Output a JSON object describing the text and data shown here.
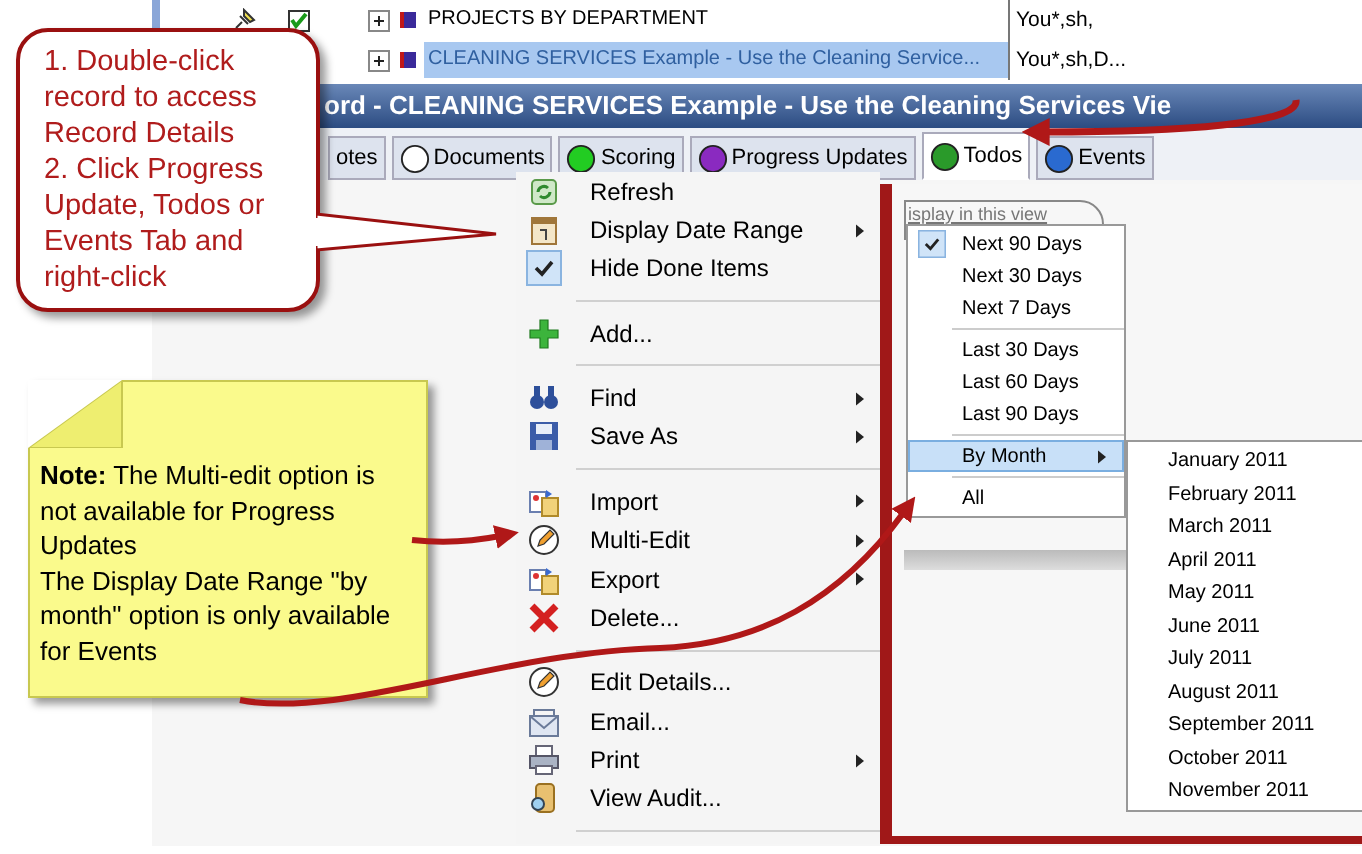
{
  "tree_rows": [
    {
      "label": "PROJECTS BY DEPARTMENT",
      "column_2": "You*,sh,",
      "selected": false
    },
    {
      "label": "CLEANING SERVICES Example - Use the Cleaning Service...",
      "column_2": "You*,sh,D...",
      "selected": true
    }
  ],
  "window": {
    "title": "ord - CLEANING SERVICES Example - Use the Cleaning Services Vie"
  },
  "tabs": [
    {
      "label": "otes",
      "selected": false
    },
    {
      "label": "Documents",
      "selected": false
    },
    {
      "label": "Scoring",
      "selected": false
    },
    {
      "label": "Progress Updates",
      "selected": false
    },
    {
      "label": "Todos",
      "selected": true
    },
    {
      "label": "Events",
      "selected": false
    }
  ],
  "context_menu": [
    {
      "kind": "item",
      "label": "Refresh",
      "submenu": false,
      "checked": false
    },
    {
      "kind": "item",
      "label": "Display Date Range",
      "submenu": true,
      "checked": false
    },
    {
      "kind": "item",
      "label": "Hide Done Items",
      "submenu": false,
      "checked": true
    },
    {
      "kind": "separator"
    },
    {
      "kind": "item",
      "label": "Add...",
      "submenu": false,
      "checked": false
    },
    {
      "kind": "separator"
    },
    {
      "kind": "item",
      "label": "Find",
      "submenu": true,
      "checked": false
    },
    {
      "kind": "item",
      "label": "Save As",
      "submenu": true,
      "checked": false
    },
    {
      "kind": "separator"
    },
    {
      "kind": "item",
      "label": "Import",
      "submenu": true,
      "checked": false
    },
    {
      "kind": "item",
      "label": "Multi-Edit",
      "submenu": true,
      "checked": false
    },
    {
      "kind": "item",
      "label": "Export",
      "submenu": true,
      "checked": false
    },
    {
      "kind": "item",
      "label": "Delete...",
      "submenu": false,
      "checked": false
    },
    {
      "kind": "separator"
    },
    {
      "kind": "item",
      "label": "Edit Details...",
      "submenu": false,
      "checked": false
    },
    {
      "kind": "item",
      "label": "Email...",
      "submenu": false,
      "checked": false
    },
    {
      "kind": "item",
      "label": "Print",
      "submenu": true,
      "checked": false
    },
    {
      "kind": "item",
      "label": "View Audit...",
      "submenu": false,
      "checked": false
    },
    {
      "kind": "separator"
    }
  ],
  "date_range_menu": {
    "caption": "isplay in this view",
    "items": [
      {
        "kind": "item",
        "label": "Next 90 Days",
        "checked": true,
        "selected": false,
        "submenu": false
      },
      {
        "kind": "item",
        "label": "Next 30 Days",
        "checked": false,
        "selected": false,
        "submenu": false
      },
      {
        "kind": "item",
        "label": "Next 7 Days",
        "checked": false,
        "selected": false,
        "submenu": false
      },
      {
        "kind": "separator"
      },
      {
        "kind": "item",
        "label": "Last 30 Days",
        "checked": false,
        "selected": false,
        "submenu": false
      },
      {
        "kind": "item",
        "label": "Last 60 Days",
        "checked": false,
        "selected": false,
        "submenu": false
      },
      {
        "kind": "item",
        "label": "Last 90 Days",
        "checked": false,
        "selected": false,
        "submenu": false
      },
      {
        "kind": "separator"
      },
      {
        "kind": "item",
        "label": "By Month",
        "checked": false,
        "selected": true,
        "submenu": true
      },
      {
        "kind": "separator"
      },
      {
        "kind": "item",
        "label": "All",
        "checked": false,
        "selected": false,
        "submenu": false
      }
    ]
  },
  "month_menu": [
    "January 2011",
    "February 2011",
    "March 2011",
    "April 2011",
    "May 2011",
    "June 2011",
    "July 2011",
    "August 2011",
    "September 2011",
    "October 2011",
    "November 2011"
  ],
  "callouts": [
    {
      "kind": "speech",
      "lines": [
        "1. Double-click record to access Record Details",
        "2. Click Progress Update, Todos or Events Tab and right-click"
      ]
    },
    {
      "kind": "note",
      "lines": [
        "**Note:** The Multi-edit option is not available for Progress Updates",
        "The Display Date Range \"by month\" option is only available for Events"
      ]
    }
  ]
}
